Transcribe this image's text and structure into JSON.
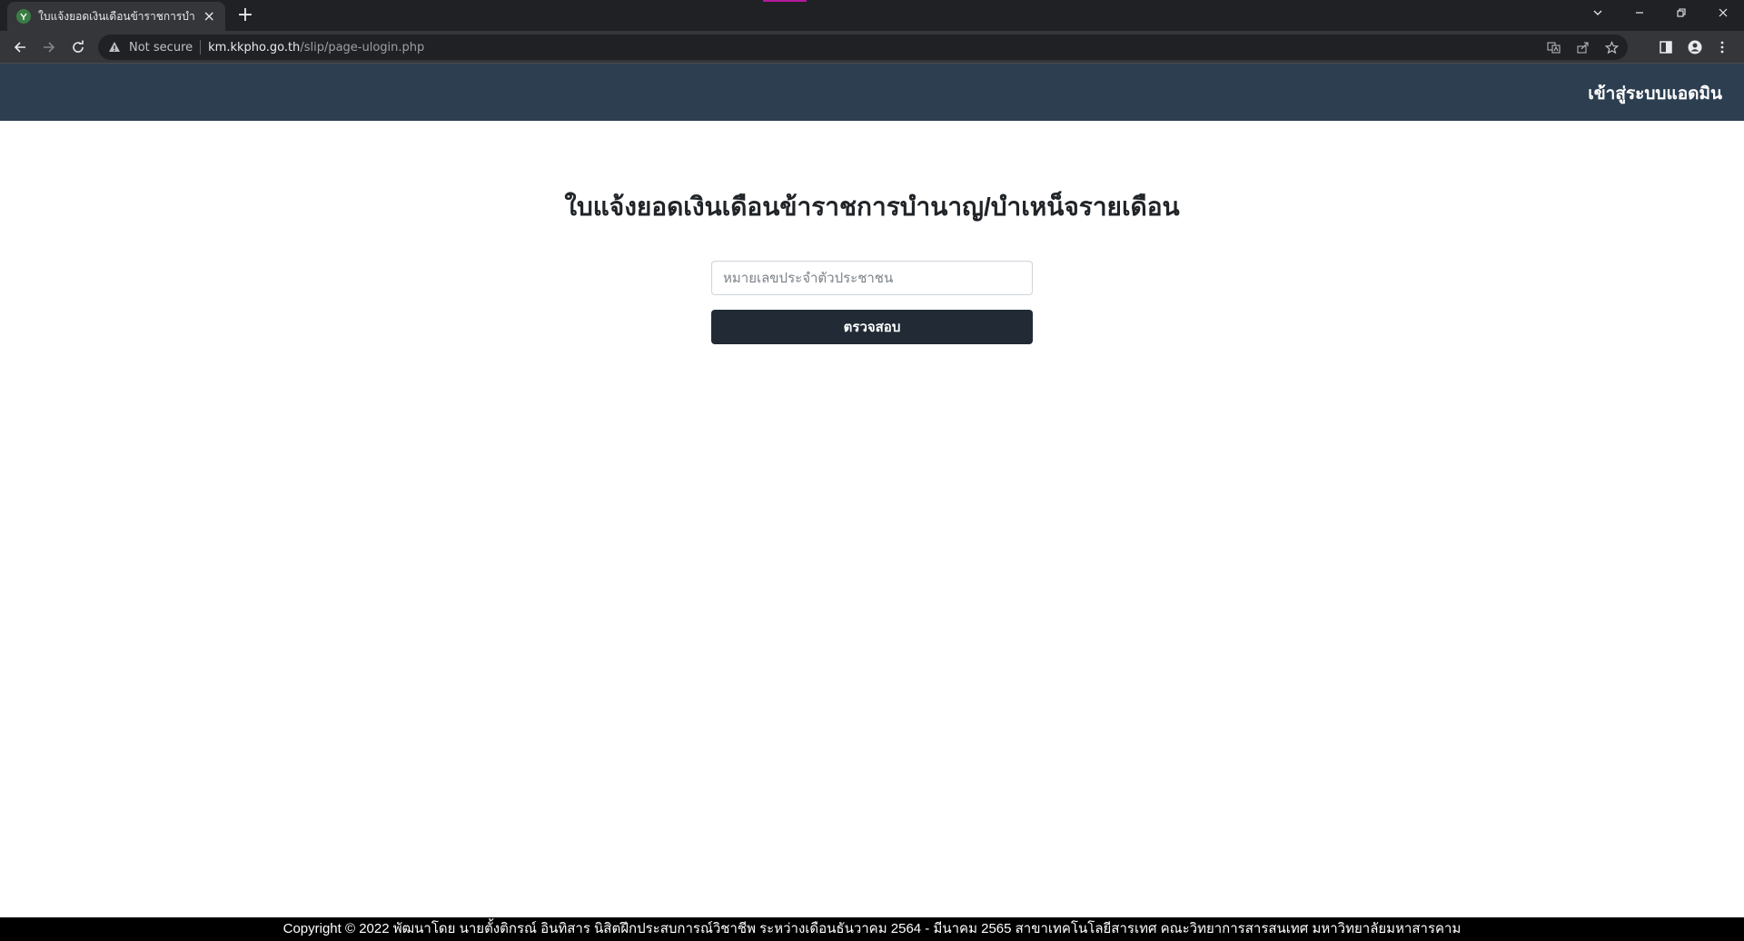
{
  "browser": {
    "tab_title": "ใบแจ้งยอดเงินเดือนข้าราชการบำนาญ/",
    "tab_close": "×",
    "new_tab": "+",
    "not_secure": "Not secure",
    "url_host": "km.kkpho.go.th",
    "url_path": "/slip/page-ulogin.php"
  },
  "navbar": {
    "admin_link": "เข้าสู่ระบบแอดมิน"
  },
  "main": {
    "title": "ใบแจ้งยอดเงินเดือนข้าราชการบำนาญ/บำเหน็จรายเดือน",
    "id_input": {
      "value": "",
      "placeholder": "หมายเลขประจำตัวประชาชน"
    },
    "check_button": "ตรวจสอบ"
  },
  "footer": {
    "text": "Copyright © 2022 พัฒนาโดย นายตั้งติกรณ์ อินทิสาร นิสิตฝึกประสบการณ์วิชาชีพ ระหว่างเดือนธันวาคม 2564 - มีนาคม 2565 สาขาเทคโนโลยีสารเทศ คณะวิทยาการสารสนเทศ มหาวิทยาลัยมหาสารคาม"
  },
  "colors": {
    "navbar_bg": "#2c3e50",
    "button_bg": "#212a35",
    "footer_bg": "#000000"
  }
}
